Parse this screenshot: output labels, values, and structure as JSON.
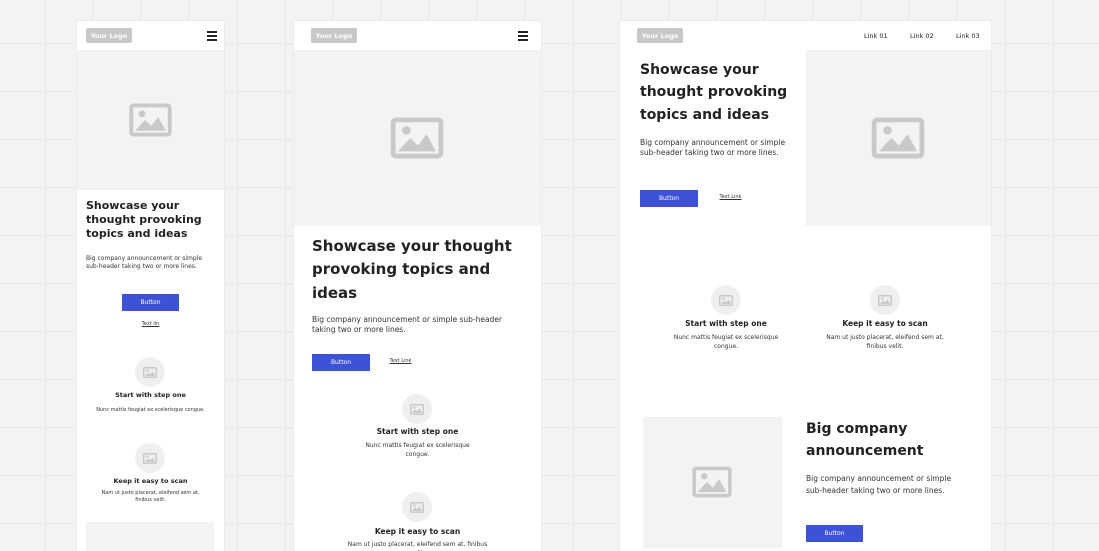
{
  "logo_label": "Your Logo",
  "hero": {
    "title": "Showcase your thought provoking topics and ideas",
    "subtitle": "Big company announcement or simple sub-header taking two or more lines.",
    "button_label": "Button"
  },
  "mobile": {
    "text_link": "Text lin"
  },
  "tablet": {
    "text_link": "Text Link"
  },
  "desktop": {
    "text_link": "Text Link",
    "nav_links": [
      "Link 01",
      "Link 02",
      "Link 03"
    ],
    "section2": {
      "title": "Big company announcement",
      "subtitle": "Big company announcement or simple sub-header taking two or more lines.",
      "button_label": "Button"
    }
  },
  "features": [
    {
      "title": "Start with step one",
      "desc": "Nunc mattis feugiat ex scelerisque congue."
    },
    {
      "title": "Keep it easy to scan",
      "desc": "Nam ut justo placerat, eleifend sem at, finibus velit."
    }
  ],
  "colors": {
    "accent": "#3e52d8",
    "placeholder": "#f3f3f3",
    "logo": "#c8c8c8"
  },
  "icons": [
    "image-placeholder-icon",
    "hamburger-menu-icon"
  ]
}
